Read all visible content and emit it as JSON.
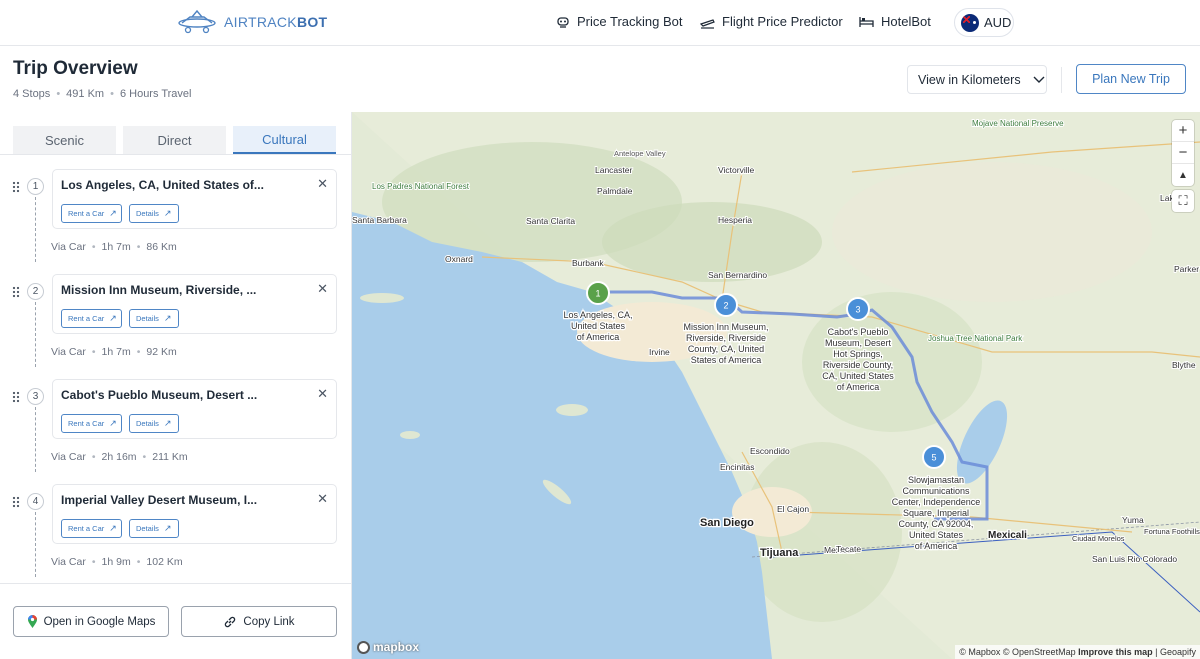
{
  "brand": {
    "name_light": "AIRTRACK",
    "name_bold": "BOT"
  },
  "nav": {
    "links": [
      "Price Tracking Bot",
      "Flight Price Predictor",
      "HotelBot"
    ],
    "currency": "AUD"
  },
  "header": {
    "title": "Trip Overview",
    "meta": [
      "4 Stops",
      "491 Km",
      "6 Hours Travel"
    ],
    "units_select": "View in Kilometers",
    "plan_button": "Plan New Trip"
  },
  "tabs": [
    "Scenic",
    "Direct",
    "Cultural"
  ],
  "active_tab": "Cultural",
  "stops": [
    {
      "num": "1",
      "title": "Los Angeles, CA, United States of...",
      "rent": "Rent a Car",
      "details": "Details",
      "leg": {
        "mode": "Via Car",
        "time": "1h 7m",
        "dist": "86 Km"
      }
    },
    {
      "num": "2",
      "title": "Mission Inn Museum, Riverside, ...",
      "rent": "Rent a Car",
      "details": "Details",
      "leg": {
        "mode": "Via Car",
        "time": "1h 7m",
        "dist": "92 Km"
      }
    },
    {
      "num": "3",
      "title": "Cabot's Pueblo Museum, Desert ...",
      "rent": "Rent a Car",
      "details": "Details",
      "leg": {
        "mode": "Via Car",
        "time": "2h 16m",
        "dist": "211 Km"
      }
    },
    {
      "num": "4",
      "title": "Imperial Valley Desert Museum, I...",
      "rent": "Rent a Car",
      "details": "Details",
      "leg": {
        "mode": "Via Car",
        "time": "1h 9m",
        "dist": "102 Km"
      }
    }
  ],
  "footer": {
    "google_maps": "Open in Google Maps",
    "copy_link": "Copy Link"
  },
  "map": {
    "markers": [
      {
        "num": "1",
        "label": [
          "Los Angeles, CA,",
          "United States",
          "of America"
        ],
        "color": "#5aa14a"
      },
      {
        "num": "2",
        "label": [
          "Mission Inn Museum,",
          "Riverside, Riverside",
          "County, CA, United",
          "States of America"
        ],
        "color": "#4a8fd8"
      },
      {
        "num": "3",
        "label": [
          "Cabot's Pueblo",
          "Museum, Desert",
          "Hot Springs,",
          "Riverside County,",
          "CA, United States",
          "of America"
        ],
        "color": "#4a8fd8"
      },
      {
        "num": "5",
        "label": [
          "Slowjamastan",
          "Communications",
          "Center, Independence",
          "Square, Imperial",
          "County, CA 92004,",
          "United States",
          "of America"
        ],
        "color": "#4a8fd8"
      }
    ],
    "places": [
      "Lancaster",
      "Palmdale",
      "Victorville",
      "Hesperia",
      "Santa Barbara",
      "Santa Clarita",
      "Oxnard",
      "Burbank",
      "San Bernardino",
      "Irvine",
      "Escondido",
      "Encinitas",
      "El Cajon",
      "San Diego",
      "Tijuana",
      "Tecate",
      "Mexicali",
      "Yuma",
      "Blythe",
      "Parker",
      "Lake H",
      "San Luis Rio Colorado",
      "Ciudad Morelos",
      "Fortuna Foothills",
      "Los Padres National Forest",
      "Joshua Tree National Park",
      "Mojave National Preserve",
      "Antelope Valley"
    ],
    "zoom_controls": [
      "+",
      "−"
    ],
    "attribution": [
      "© Mapbox",
      "© OpenStreetMap",
      "Improve this map",
      "Geoapify"
    ],
    "logo": "mapbox"
  }
}
